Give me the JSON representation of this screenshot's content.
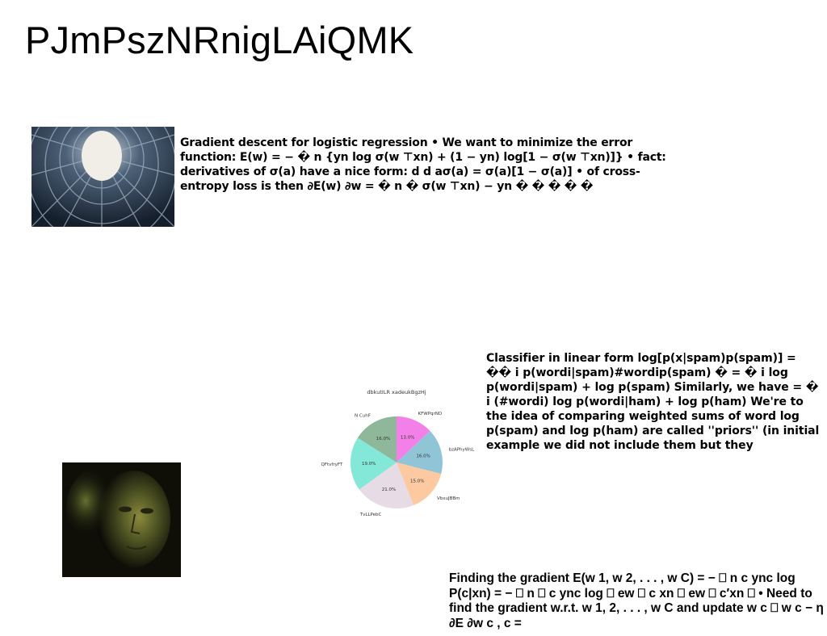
{
  "page": {
    "title": "PJmPszNRnigLAiQMK"
  },
  "blocks": {
    "gradient_descent": "Gradient descent for logistic regression • We want to minimize the error function: E(w) = − � n {yn log σ(w ⊤xn) + (1 − yn) log[1 − σ(w ⊤xn)]} • fact: derivatives of σ(a) have a nice form: d d aσ(a) = σ(a)[1 − σ(a)] • of cross-entropy loss is then ∂E(w) ∂w = � n � σ(w ⊤xn) − yn � � � � �",
    "classifier": "Classifier in linear form log[p(x|spam)p(spam)] = �� i p(wordi|spam)#wordip(spam) � = � i log p(wordi|spam) + log p(spam) Similarly, we have = � i (#wordi) log p(wordi|ham) + log p(ham) We're to the idea of comparing weighted sums of word log p(spam) and log p(ham) are called ''priors'' (in initial example we did not include them but they",
    "finding_gradient": "Finding the gradient E(w 1, w 2, . . . , w C) = − ⎕ n c ync log P(c|xn) = − ⎕ n ⎕ c ync log ⎕ ew ⎕ c xn ⎕ ew ⎕ c′xn ⎕ • Need to find the gradient w.r.t. w 1, 2, . . . , w C and update w c ⎕ w c − η ∂E ∂w c , c ="
  },
  "images": {
    "tunnel": "architectural tunnel skylight photo",
    "face": "green-tinted face photo"
  },
  "chart_data": {
    "type": "pie",
    "title": "dbkutILR xadeukBgzHj",
    "categories": [
      "KFWPqrND",
      "bzAPhyWsL",
      "VbxuJBBm",
      "TvLLPebC",
      "QFtvfryFT",
      "N CuhF"
    ],
    "values": [
      13.0,
      16.0,
      15.0,
      21.0,
      19.0,
      16.0
    ],
    "labels": [
      "13.0%",
      "16.0%",
      "15.0%",
      "21.0%",
      "19.0%",
      "16.0%"
    ],
    "colors": [
      "#f280e8",
      "#8fc5d6",
      "#fcc9a0",
      "#e7dbe6",
      "#84e8d8",
      "#8fb79a"
    ]
  }
}
